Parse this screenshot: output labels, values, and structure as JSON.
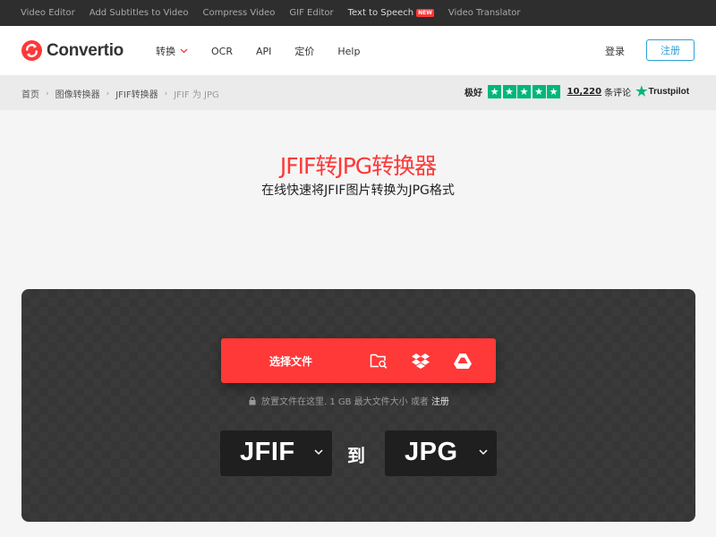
{
  "topbar": {
    "links": [
      "Video Editor",
      "Add Subtitles to Video",
      "Compress Video",
      "GIF Editor",
      "Text to Speech",
      "Video Translator"
    ],
    "new_badge": "NEW"
  },
  "header": {
    "brand": "Convertio",
    "nav": {
      "convert": "转换",
      "ocr": "OCR",
      "api": "API",
      "pricing": "定价",
      "help": "Help"
    },
    "login": "登录",
    "signup": "注册"
  },
  "breadcrumb": [
    "首页",
    "图像转换器",
    "JFIF转换器",
    "JFIF 为 JPG"
  ],
  "rating": {
    "label": "极好",
    "stars": 5,
    "reviews": "10,220",
    "reviews_suffix": "条评论",
    "provider": "Trustpilot"
  },
  "hero": {
    "title": "JFIF转JPG转换器",
    "subtitle": "在线快速将JFIF图片转换为JPG格式"
  },
  "converter": {
    "choose_label": "选择文件",
    "icons": [
      "folder-search-icon",
      "dropbox-icon",
      "google-drive-icon"
    ],
    "hint": "放置文件在这里. 1 GB 最大文件大小 或者",
    "hint_link": "注册",
    "from_format": "JFIF",
    "to_label": "到",
    "to_format": "JPG"
  },
  "colors": {
    "accent": "#ff3838",
    "link": "#2f9ed6",
    "trustpilot": "#00b67a",
    "panel": "#3a3a3a"
  }
}
